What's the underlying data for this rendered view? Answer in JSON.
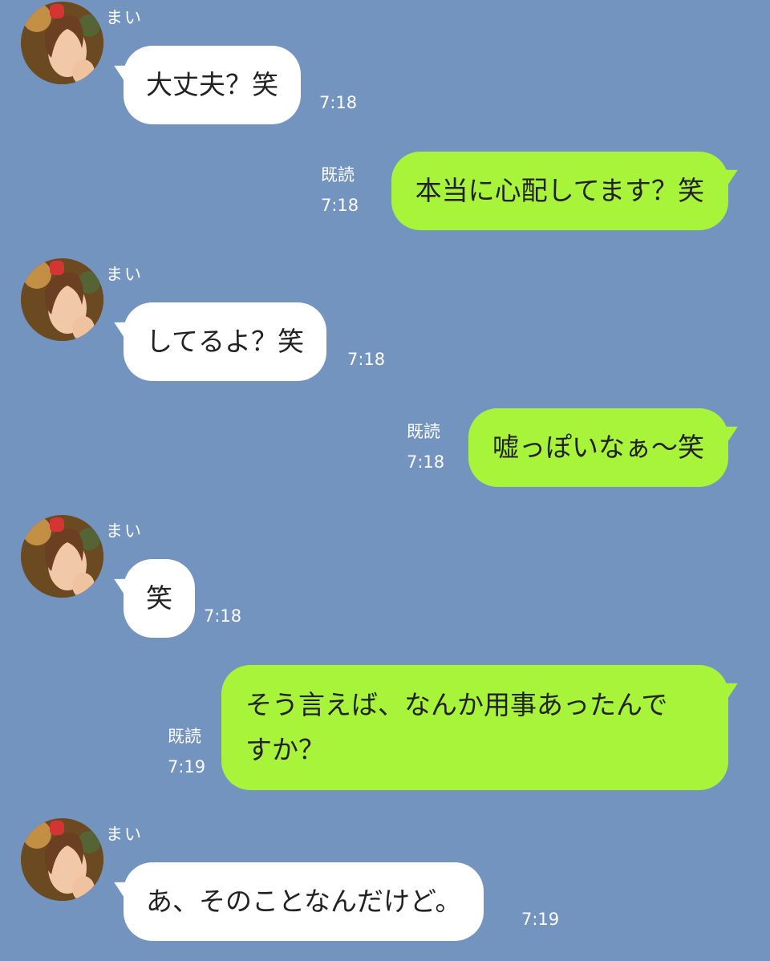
{
  "contact": {
    "name": "まい"
  },
  "colors": {
    "background": "#7494c0",
    "incoming_bubble": "#ffffff",
    "outgoing_bubble": "#a8f43b"
  },
  "messages": [
    {
      "direction": "in",
      "text": "大丈夫？笑",
      "time": "7:18"
    },
    {
      "direction": "out",
      "text": "本当に心配してます？笑",
      "read": "既読",
      "time": "7:18"
    },
    {
      "direction": "in",
      "text": "してるよ？笑",
      "time": "7:18"
    },
    {
      "direction": "out",
      "text": "嘘っぽいなぁ〜笑",
      "read": "既読",
      "time": "7:18"
    },
    {
      "direction": "in",
      "text": "笑",
      "time": "7:18"
    },
    {
      "direction": "out",
      "text_line1": "そう言えば、なんか用事あったんで",
      "text_line2": "すか？",
      "read": "既読",
      "time": "7:19"
    },
    {
      "direction": "in",
      "text": "あ、そのことなんだけど。",
      "time": "7:19"
    }
  ]
}
